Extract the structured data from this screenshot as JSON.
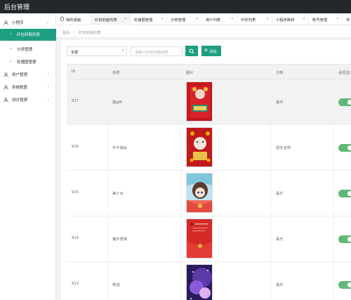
{
  "app": {
    "title": "后台管理"
  },
  "sidebar": {
    "items": [
      {
        "label": "小程序",
        "icon": "user-icon",
        "arrow": "⌄"
      },
      {
        "label": "红包封面列表",
        "active": true
      },
      {
        "label": "分类管理"
      },
      {
        "label": "轮播图管理"
      },
      {
        "label": "用户管理",
        "icon": "user-icon",
        "arrow": "‹"
      },
      {
        "label": "系统配置",
        "icon": "user-icon",
        "arrow": "‹"
      },
      {
        "label": "测评管理",
        "icon": "user-icon",
        "arrow": "‹"
      }
    ]
  },
  "tabs": [
    {
      "label": "我的桌面",
      "home": true
    },
    {
      "label": "红包封面列表",
      "active": true
    },
    {
      "label": "轮播图管理"
    },
    {
      "label": "分类管理"
    },
    {
      "label": "用户列表"
    },
    {
      "label": "中奖列表"
    },
    {
      "label": "小程序跳转"
    },
    {
      "label": "账号管理"
    },
    {
      "label": "宋"
    }
  ],
  "breadcrumb": {
    "home": "首页",
    "separator": "/",
    "current": "红包封面列表"
  },
  "filter": {
    "select_value": "全部",
    "search_placeholder": "请输入红包封面名称",
    "add_label": "添加"
  },
  "table": {
    "headers": {
      "id": "ID",
      "name": "名称",
      "image": "图片",
      "category": "分类",
      "status": "是否显示"
    },
    "rows": [
      {
        "id": "917",
        "name": "鼠gift",
        "category": "喜乐",
        "enabled": true,
        "thumb": "gift"
      },
      {
        "id": "916",
        "name": "牛牛我此",
        "category": "招年吉祥",
        "enabled": true,
        "thumb": "cow"
      },
      {
        "id": "915",
        "name": "美少女",
        "category": "喜乐",
        "enabled": true,
        "thumb": "girl"
      },
      {
        "id": "914",
        "name": "猪不爱我",
        "category": "喜乐",
        "enabled": true,
        "thumb": "plain"
      },
      {
        "id": "913",
        "name": "奇迹",
        "category": "喜乐",
        "enabled": true,
        "thumb": "space"
      }
    ]
  },
  "colors": {
    "accent": "#1e9e82",
    "toggle": "#5fb878",
    "topbar": "#24272b"
  }
}
